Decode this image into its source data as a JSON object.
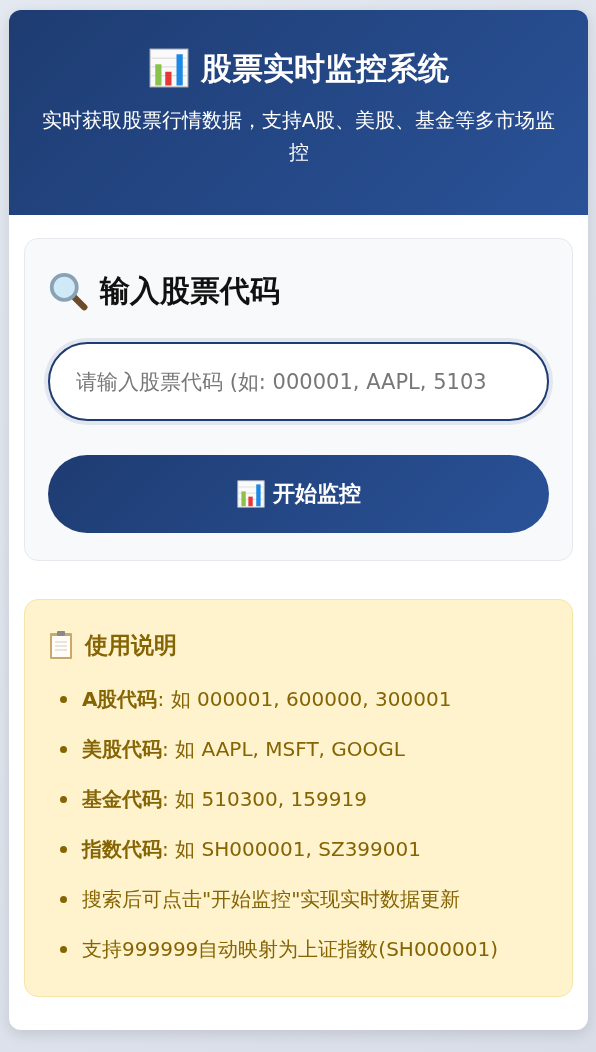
{
  "header": {
    "title": "股票实时监控系统",
    "subtitle": "实时获取股票行情数据，支持A股、美股、基金等多市场监控"
  },
  "search": {
    "heading": "输入股票代码",
    "input": {
      "placeholder": "请输入股票代码 (如: 000001, AAPL, 5103",
      "focused": true
    },
    "button": "开始监控"
  },
  "instructions": {
    "heading": "使用说明",
    "items": [
      "**A股代码**: 如 000001, 600000, 300001",
      "**美股代码**: 如 AAPL, MSFT, GOOGL",
      "**基金代码**: 如 510300, 159919",
      "**指数代码**: 如 SH000001, SZ399001",
      "搜索后可点击\"开始监控\"实现实时数据更新",
      "支持999999自动映射为上证指数(SH000001)"
    ]
  }
}
